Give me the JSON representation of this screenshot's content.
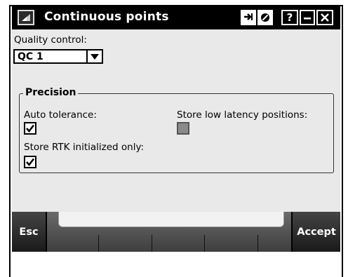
{
  "window": {
    "title": "Continuous points",
    "buttons": {
      "arrow_icon": "switch-arrow-icon",
      "stop_icon": "no-entry-icon",
      "help": "?",
      "minimize": "_",
      "close": "X"
    }
  },
  "form": {
    "quality_control_label": "Quality control:",
    "quality_control_value": "QC 1",
    "precision_title": "Precision",
    "auto_tolerance_label": "Auto tolerance:",
    "auto_tolerance_checked": true,
    "store_low_latency_label": "Store low latency positions:",
    "store_low_latency_checked": false,
    "store_rtk_label": "Store RTK initialized only:",
    "store_rtk_checked": true
  },
  "softkeys": {
    "esc": "Esc",
    "accept": "Accept"
  }
}
